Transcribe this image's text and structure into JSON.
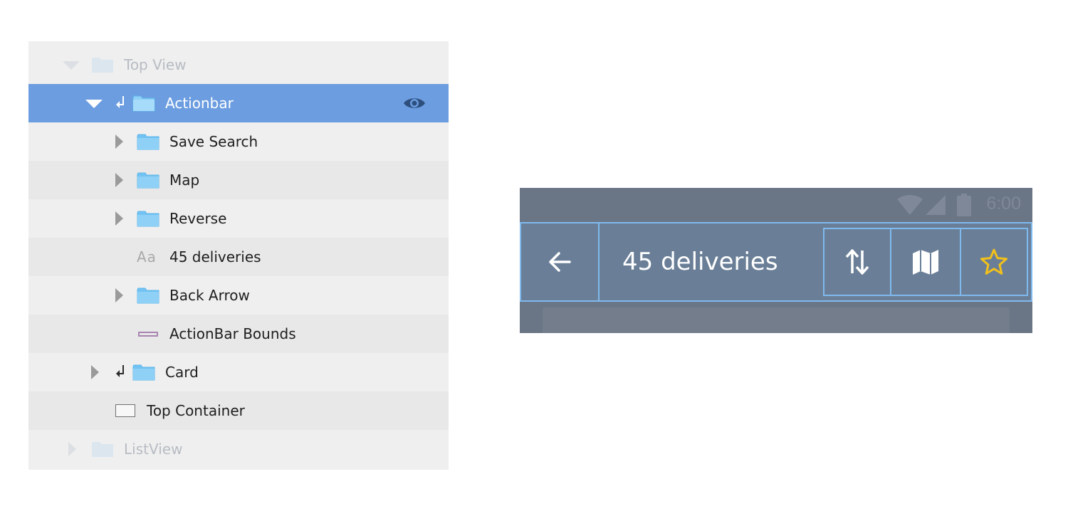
{
  "layers": {
    "rows": [
      {
        "label": "Top View"
      },
      {
        "label": "Actionbar"
      },
      {
        "label": "Save Search"
      },
      {
        "label": "Map"
      },
      {
        "label": "Reverse"
      },
      {
        "label": "45 deliveries",
        "icon_text": "Aa"
      },
      {
        "label": "Back Arrow"
      },
      {
        "label": "ActionBar Bounds"
      },
      {
        "label": "Card"
      },
      {
        "label": "Top Container"
      },
      {
        "label": "ListView"
      }
    ]
  },
  "phone": {
    "status_time": "6:00",
    "title": "45 deliveries",
    "accent_color": "#7fb9ee",
    "star_color": "#f2c01b"
  }
}
